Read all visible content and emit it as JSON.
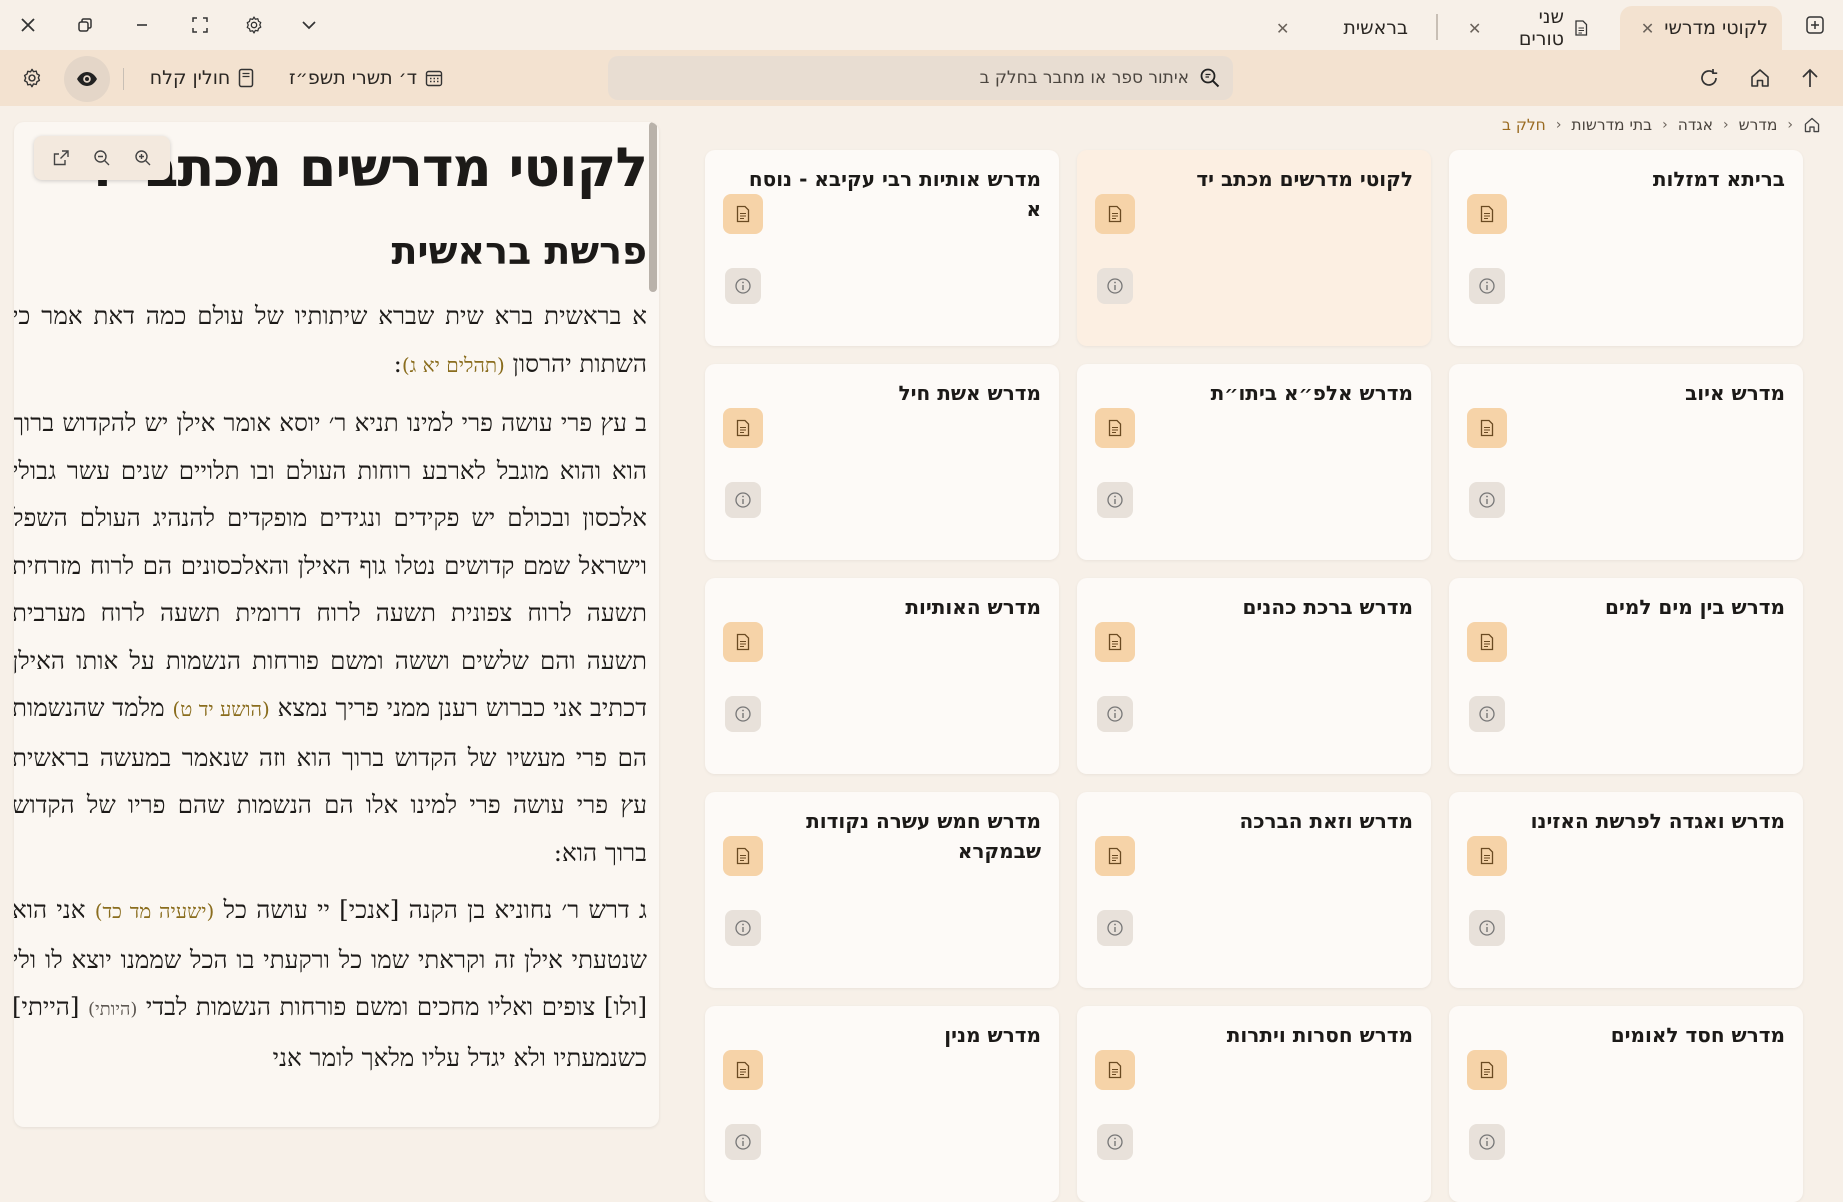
{
  "tabs": [
    {
      "label": "לקוטי מדרשי",
      "active": true
    },
    {
      "label": "שני טורים",
      "active": false
    },
    {
      "label": "בראשית",
      "active": false
    }
  ],
  "window_controls": [
    "close-icon",
    "restore-icon",
    "minimize-icon",
    "fullscreen-icon",
    "gear-icon",
    "chevron-down-icon"
  ],
  "toolbar": {
    "search_placeholder": "איתור ספר או מחבר בחלק ב",
    "date_label": "ד׳ תשרי תשפ״ז",
    "daf_label": "חולין קלח"
  },
  "breadcrumb": [
    "מדרש",
    "אגדה",
    "בתי מדרשות",
    "חלק ב"
  ],
  "reader": {
    "title": "לקוטי מדרשים מכתב יד",
    "chapter": "פרשת בראשית",
    "paragraphs": [
      {
        "text": "א בראשית ברא שית שברא שיתותיו של עולם כמה דאת אמר כי השתות יהרסון ",
        "ref": "(תהלים יא ג)",
        "tail": ":"
      },
      {
        "text": "ב עץ פרי עושה פרי למינו תניא ר׳ יוסא אומר אילן יש להקדוש ברוך הוא והוא מוגבל לארבע רוחות העולם ובו תלויים שנים עשר גבולי אלכסון ובכולם יש פקידים ונגידים מופקדים להנהיג העולם השפל וישראל שמם קדושים נטלו גוף האילן והאלכסונים הם לרוח מזרחית תשעה לרוח צפונית תשעה לרוח דרומית תשעה לרוח מערבית תשעה והם שלשים וששה ומשם פורחות הנשמות על אותו האילן דכתיב אני כברוש רענן ממני פריך נמצא ",
        "ref": "(הושע יד ט)",
        "tail": " מלמד שהנשמות הם פרי מעשיו של הקדוש ברוך הוא וזה שנאמר במעשה בראשית עץ פרי עושה פרי למינו אלו הם הנשמות שהם פריו של הקדוש ברוך הוא:"
      },
      {
        "text": "ג דרש ר׳ נחוניא בן הקנה [אנכי] יי עושה כל ",
        "ref": "(ישעיה מד כד)",
        "tail": " אני הוא שנטעתי אילן זה וקראתי שמו כל ורקעתי בו הכל שממנו יוצא לו ולי [ולו] צופים ואליו מחכים ומשם פורחות הנשמות לבדי ",
        "ref2": "(היותי)",
        "tail2": " [הייתי] כשנמעתיו ולא יגדל עליו מלאך לומר אני"
      }
    ]
  },
  "cards": [
    {
      "title": "בריתא דמזלות"
    },
    {
      "title": "לקוטי מדרשים מכתב יד",
      "highlight": true
    },
    {
      "title": "מדרש אותיות רבי עקיבא - נוסח א"
    },
    {
      "title": "מדרש איוב"
    },
    {
      "title": "מדרש אלפ״א ביתו״ת"
    },
    {
      "title": "מדרש אשת חיל"
    },
    {
      "title": "מדרש בין מים למים"
    },
    {
      "title": "מדרש ברכת כהנים"
    },
    {
      "title": "מדרש האותיות"
    },
    {
      "title": "מדרש ואגדה לפרשת האזינו"
    },
    {
      "title": "מדרש וזאת הברכה"
    },
    {
      "title": "מדרש חמש עשרה נקודות שבמקרא"
    },
    {
      "title": "מדרש חסד לאומים"
    },
    {
      "title": "מדרש חסרות ויתרות"
    },
    {
      "title": "מדרש מנין"
    }
  ],
  "colors": {
    "background": "#f7f0e8",
    "toolbar": "#f3e2d0",
    "accent": "#f6d3a8",
    "reference": "#8a6d1e",
    "crumb_active": "#9a6b22"
  }
}
